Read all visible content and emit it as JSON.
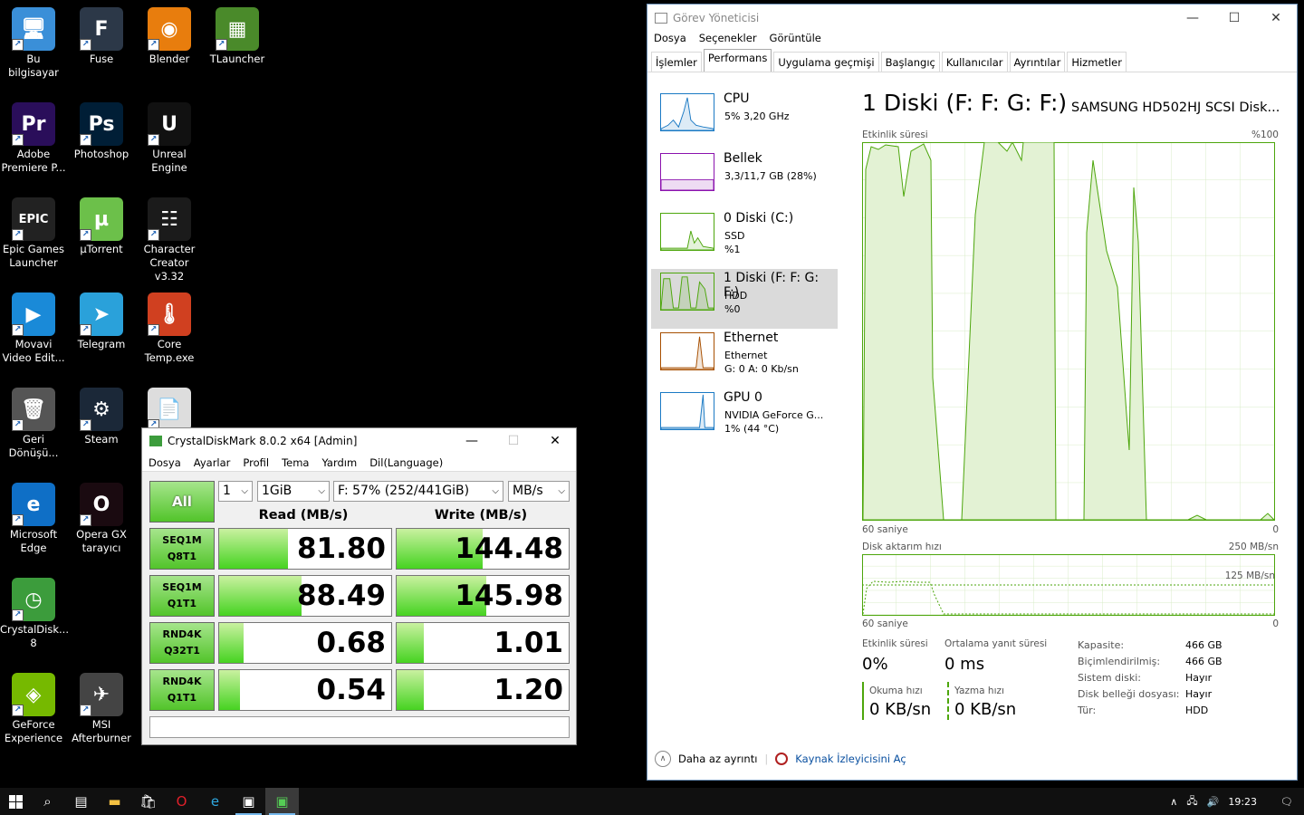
{
  "desktop_icons": [
    {
      "label": "Bu bilgisayar",
      "icon": "computer-icon",
      "color": "#3a8fd8",
      "glyph": "🖥"
    },
    {
      "label": "Fuse",
      "icon": "fuse-icon",
      "color": "#2c3848",
      "glyph": "F"
    },
    {
      "label": "Blender",
      "icon": "blender-icon",
      "color": "#e87d0d",
      "glyph": "◉"
    },
    {
      "label": "TLauncher",
      "icon": "tlauncher-icon",
      "color": "#4a8a2a",
      "glyph": "▦"
    },
    {
      "label": "Adobe Premiere P...",
      "icon": "premiere-icon",
      "color": "#2a0e5a",
      "glyph": "Pr"
    },
    {
      "label": "Photoshop",
      "icon": "photoshop-icon",
      "color": "#001e36",
      "glyph": "Ps"
    },
    {
      "label": "Unreal Engine",
      "icon": "unreal-icon",
      "color": "#111111",
      "glyph": "U"
    },
    {
      "label": "Epic Games Launcher",
      "icon": "epic-icon",
      "color": "#222222",
      "glyph": "EPIC"
    },
    {
      "label": "µTorrent",
      "icon": "utorrent-icon",
      "color": "#6cc04a",
      "glyph": "µ"
    },
    {
      "label": "Character Creator v3.32",
      "icon": "character-creator-icon",
      "color": "#1b1b1b",
      "glyph": "☷"
    },
    {
      "label": "Movavi Video Edit...",
      "icon": "movavi-icon",
      "color": "#1a8ad8",
      "glyph": "▶"
    },
    {
      "label": "Telegram",
      "icon": "telegram-icon",
      "color": "#2aa1da",
      "glyph": "➤"
    },
    {
      "label": "Core Temp.exe",
      "icon": "coretemp-icon",
      "color": "#d04020",
      "glyph": "🌡"
    },
    {
      "label": "Geri Dönüşü...",
      "icon": "recycle-bin-icon",
      "color": "#555555",
      "glyph": "🗑"
    },
    {
      "label": "Steam",
      "icon": "steam-icon",
      "color": "#1b2838",
      "glyph": "⚙"
    },
    {
      "label": "",
      "icon": "file-icon",
      "color": "#dddddd",
      "glyph": "📄"
    },
    {
      "label": "Microsoft Edge",
      "icon": "edge-icon",
      "color": "#0f6fc6",
      "glyph": "e"
    },
    {
      "label": "Opera GX tarayıcı",
      "icon": "opera-gx-icon",
      "color": "#1a0a10",
      "glyph": "O"
    },
    {
      "label": "CrystalDisk... 8",
      "icon": "crystaldisk-icon",
      "color": "#3c9c3c",
      "glyph": "◷"
    },
    {
      "label": "GeForce Experience",
      "icon": "geforce-icon",
      "color": "#76b900",
      "glyph": "◈"
    },
    {
      "label": "MSI Afterburner",
      "icon": "afterburner-icon",
      "color": "#444444",
      "glyph": "✈"
    }
  ],
  "taskmanager": {
    "title": "Görev Yöneticisi",
    "menu": [
      "Dosya",
      "Seçenekler",
      "Görüntüle"
    ],
    "tabs": [
      "İşlemler",
      "Performans",
      "Uygulama geçmişi",
      "Başlangıç",
      "Kullanıcılar",
      "Ayrıntılar",
      "Hizmetler"
    ],
    "side": [
      {
        "name": "CPU",
        "l1": "5% 3,20 GHz",
        "l2": "",
        "color": "#1b7ac4"
      },
      {
        "name": "Bellek",
        "l1": "3,3/11,7 GB (28%)",
        "l2": "",
        "color": "#8b12ae"
      },
      {
        "name": "0 Diski (C:)",
        "l1": "SSD",
        "l2": "%1",
        "color": "#4da60c"
      },
      {
        "name": "1 Diski (F: F: G: F:)",
        "l1": "HDD",
        "l2": "%0",
        "color": "#4da60c"
      },
      {
        "name": "Ethernet",
        "l1": "Ethernet",
        "l2": "G: 0 A: 0 Kb/sn",
        "color": "#a74f01"
      },
      {
        "name": "GPU 0",
        "l1": "NVIDIA GeForce G...",
        "l2": "1% (44 °C)",
        "color": "#1b7ac4"
      }
    ],
    "main": {
      "title": "1 Diski (F: F: G: F:)",
      "model": "SAMSUNG HD502HJ SCSI Disk...",
      "graph1_label": "Etkinlik süresi",
      "graph1_max": "%100",
      "graph1_time": "60 saniye",
      "graph1_min": "0",
      "graph2_label": "Disk aktarım hızı",
      "graph2_max": "250 MB/sn",
      "graph2_mid": "125 MB/sn",
      "graph2_time": "60 saniye",
      "graph2_min": "0",
      "stats": {
        "activity_label": "Etkinlik süresi",
        "activity_value": "0%",
        "response_label": "Ortalama yanıt süresi",
        "response_value": "0 ms",
        "read_label": "Okuma hızı",
        "read_value": "0 KB/sn",
        "write_label": "Yazma hızı",
        "write_value": "0 KB/sn"
      },
      "props": [
        {
          "k": "Kapasite:",
          "v": "466 GB"
        },
        {
          "k": "Biçimlendirilmiş:",
          "v": "466 GB"
        },
        {
          "k": "Sistem diski:",
          "v": "Hayır"
        },
        {
          "k": "Disk belleği dosyası:",
          "v": "Hayır"
        },
        {
          "k": "Tür:",
          "v": "HDD"
        }
      ]
    },
    "footer": {
      "fewer": "Daha az ayrıntı",
      "resmon": "Kaynak İzleyicisini Aç"
    }
  },
  "cdm": {
    "title": "CrystalDiskMark 8.0.2 x64 [Admin]",
    "menu": [
      "Dosya",
      "Ayarlar",
      "Profil",
      "Tema",
      "Yardım",
      "Dil(Language)"
    ],
    "all_label": "All",
    "count": "1",
    "size": "1GiB",
    "drive": "F: 57% (252/441GiB)",
    "unit": "MB/s",
    "read_header": "Read (MB/s)",
    "write_header": "Write (MB/s)",
    "rows": [
      {
        "l1": "SEQ1M",
        "l2": "Q8T1",
        "read": "81.80",
        "write": "144.48",
        "read_fill": 0.4,
        "write_fill": 0.5
      },
      {
        "l1": "SEQ1M",
        "l2": "Q1T1",
        "read": "88.49",
        "write": "145.98",
        "read_fill": 0.48,
        "write_fill": 0.52
      },
      {
        "l1": "RND4K",
        "l2": "Q32T1",
        "read": "0.68",
        "write": "1.01",
        "read_fill": 0.14,
        "write_fill": 0.16
      },
      {
        "l1": "RND4K",
        "l2": "Q1T1",
        "read": "0.54",
        "write": "1.20",
        "read_fill": 0.12,
        "write_fill": 0.16
      }
    ]
  },
  "taskbar": {
    "clock": "19:23"
  }
}
